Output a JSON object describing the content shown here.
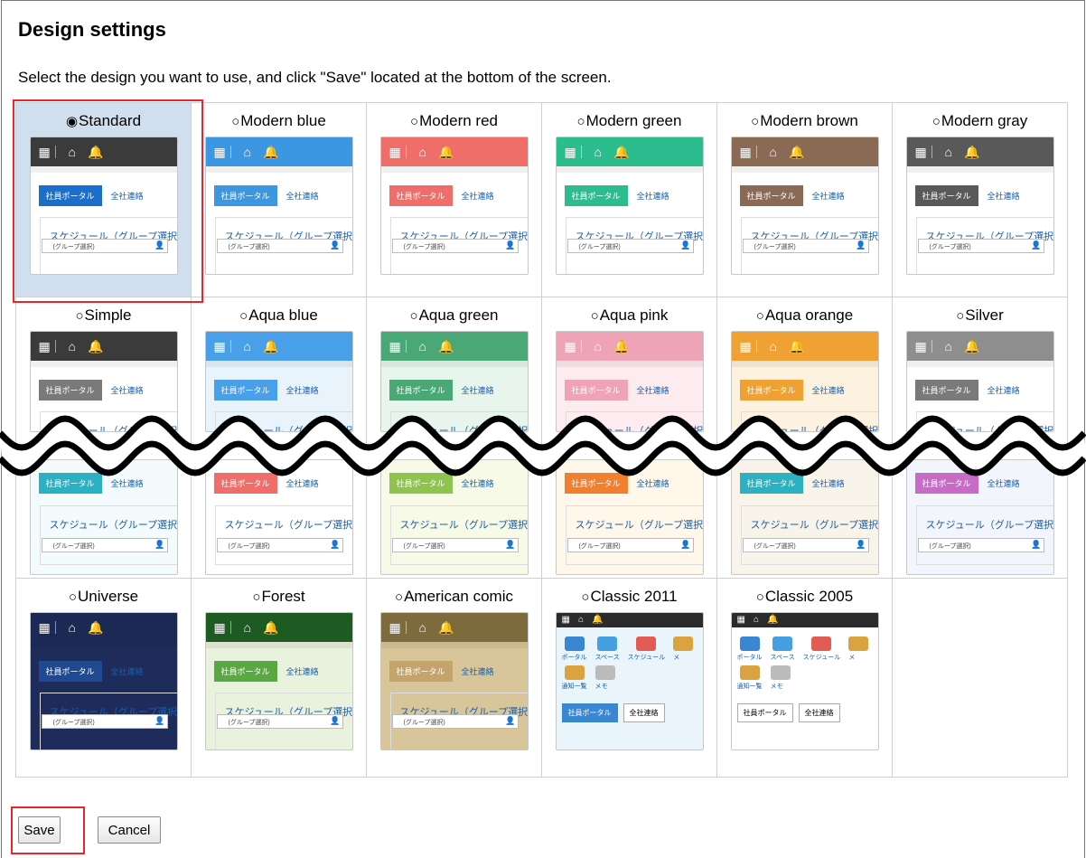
{
  "page": {
    "title": "Design settings",
    "description": "Select the design you want to use, and click \"Save\" located at the bottom of the screen."
  },
  "thumb_text": {
    "tab_portal": "社員ポータル",
    "tab_notice": "全社連絡",
    "schedule": "スケジュール（グループ選択）",
    "group_select": "(グループ選択)",
    "classic_icons": [
      "ポータル",
      "スペース",
      "スケジュール",
      "メ"
    ],
    "classic_icons2": [
      "通知一覧",
      "メモ"
    ]
  },
  "radio_glyphs": {
    "selected": "◉",
    "unselected": "○"
  },
  "rows": [
    {
      "designs": [
        {
          "label": "Standard",
          "selected": true,
          "header": "#3b3b3b",
          "tab": "#1a6fcd",
          "bg": "#ffffff"
        },
        {
          "label": "Modern blue",
          "selected": false,
          "header": "#3c97e2",
          "tab": "#3c97e2",
          "bg": "#ffffff"
        },
        {
          "label": "Modern red",
          "selected": false,
          "header": "#f06e6a",
          "tab": "#f06e6a",
          "bg": "#ffffff"
        },
        {
          "label": "Modern green",
          "selected": false,
          "header": "#2bbd8e",
          "tab": "#2bbd8e",
          "bg": "#ffffff"
        },
        {
          "label": "Modern brown",
          "selected": false,
          "header": "#8b6a55",
          "tab": "#8b6a55",
          "bg": "#ffffff"
        },
        {
          "label": "Modern gray",
          "selected": false,
          "header": "#595959",
          "tab": "#595959",
          "bg": "#ffffff"
        }
      ]
    },
    {
      "designs": [
        {
          "label": "Simple",
          "selected": false,
          "header": "#3b3b3b",
          "tab": "#7a7a7a",
          "bg": "#ffffff",
          "lower_tab": "#2bb1c2",
          "lower_bg": "#f3fbfd"
        },
        {
          "label": "Aqua blue",
          "selected": false,
          "header": "#4a9fe9",
          "tab": "#4a9fe9",
          "bg": "#e9f3fc",
          "lower_tab": "#f06e6a",
          "lower_bg": "#ffffff"
        },
        {
          "label": "Aqua green",
          "selected": false,
          "header": "#4aa877",
          "tab": "#4aa877",
          "bg": "#e8f5ed",
          "lower_tab": "#8ec44e",
          "lower_bg": "#f6fae6"
        },
        {
          "label": "Aqua pink",
          "selected": false,
          "header": "#efa3b6",
          "tab": "#efa3b6",
          "bg": "#fcecf0",
          "lower_tab": "#f07f2e",
          "lower_bg": "#fff8ea"
        },
        {
          "label": "Aqua orange",
          "selected": false,
          "header": "#f0a133",
          "tab": "#f0a133",
          "bg": "#fdf2e0",
          "lower_tab": "#2bb1c2",
          "lower_bg": "#f9f4ea"
        },
        {
          "label": "Silver",
          "selected": false,
          "header": "#8e8e8e",
          "tab": "#7a7a7a",
          "bg": "#ffffff",
          "lower_tab": "#c86bc7",
          "lower_bg": "#f2f5fb"
        }
      ]
    },
    {
      "designs": [
        {
          "label": "Universe",
          "selected": false,
          "header": "#1a2a55",
          "tab": "#1f4a92",
          "bg": "#1d2c5a",
          "kind": "modern"
        },
        {
          "label": "Forest",
          "selected": false,
          "header": "#1e5b22",
          "tab": "#5aa842",
          "bg": "#e9f2dd",
          "kind": "modern"
        },
        {
          "label": "American comic",
          "selected": false,
          "header": "#7d6a3d",
          "tab": "#c4a46b",
          "bg": "#d8c59a",
          "kind": "modern"
        },
        {
          "label": "Classic 2011",
          "selected": false,
          "header": "#2b2b2b",
          "tab": "#3a87d1",
          "bg": "#eaf4fb",
          "kind": "classic"
        },
        {
          "label": "Classic 2005",
          "selected": false,
          "header": "#2b2b2b",
          "tab": "#ffffff",
          "bg": "#ffffff",
          "kind": "classic"
        }
      ]
    }
  ],
  "buttons": {
    "save": "Save",
    "cancel": "Cancel"
  }
}
